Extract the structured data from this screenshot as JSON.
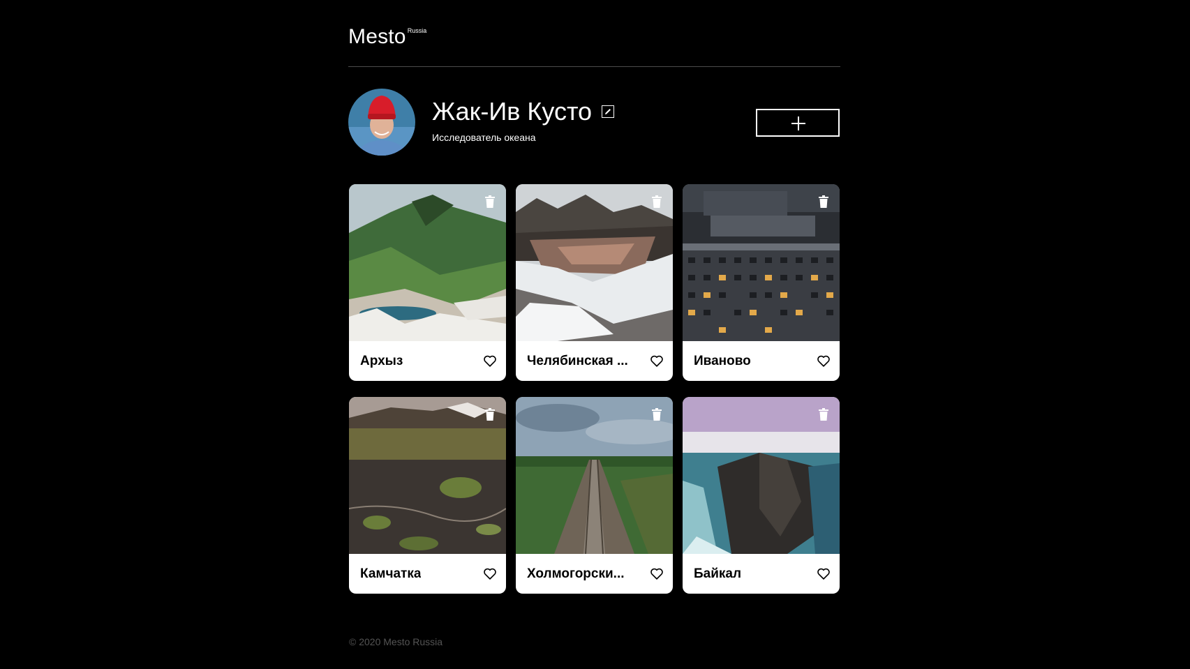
{
  "header": {
    "logo_main": "Mesto",
    "logo_sub": "Russia"
  },
  "profile": {
    "name": "Жак-Ив Кусто",
    "about": "Исследователь океана"
  },
  "cards": [
    {
      "title": "Архыз",
      "image": "mountain-valley-green"
    },
    {
      "title": "Челябинская ...",
      "image": "snowy-river-forest"
    },
    {
      "title": "Иваново",
      "image": "apartment-blocks-night"
    },
    {
      "title": "Камчатка",
      "image": "tundra-volcano"
    },
    {
      "title": "Холмогорски...",
      "image": "railway-through-forest"
    },
    {
      "title": "Байкал",
      "image": "frozen-lake-cliff"
    }
  ],
  "footer": {
    "copyright": "© 2020 Mesto Russia"
  },
  "colors": {
    "background": "#000000",
    "card": "#ffffff",
    "divider": "#545454",
    "footer_text": "#545454"
  }
}
